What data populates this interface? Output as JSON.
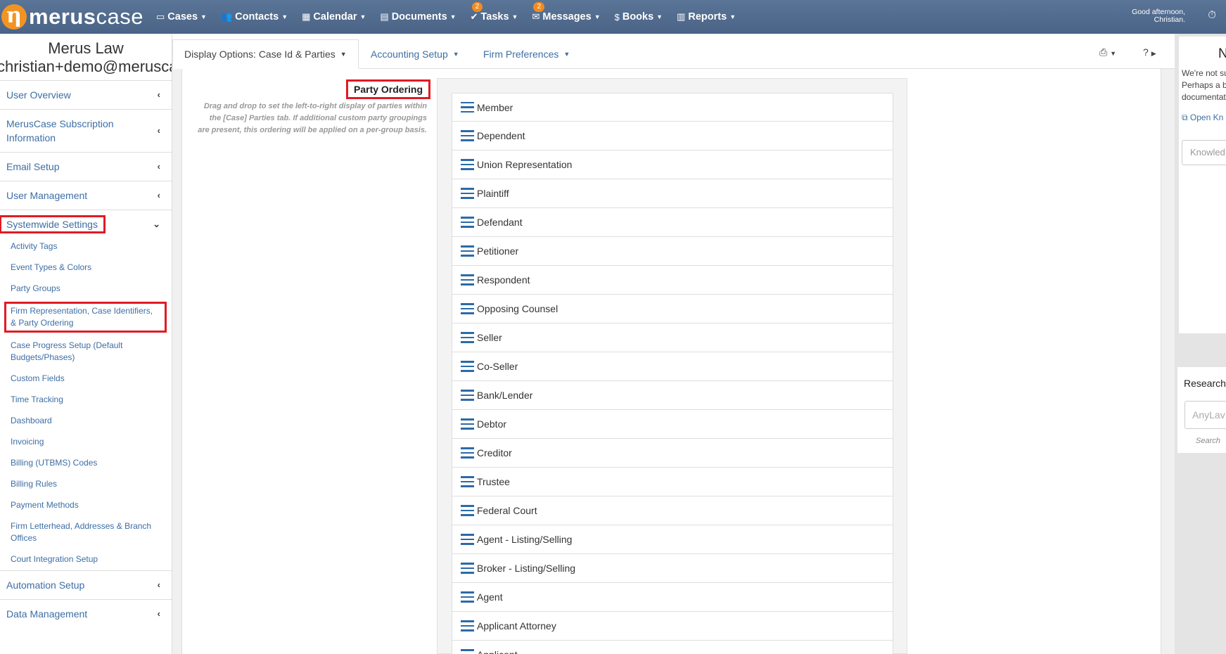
{
  "topbar": {
    "logo_text_bold": "merus",
    "logo_text_light": "case",
    "nav": [
      {
        "label": "Cases",
        "icon": "folder-icon"
      },
      {
        "label": "Contacts",
        "icon": "users-icon"
      },
      {
        "label": "Calendar",
        "icon": "calendar-icon"
      },
      {
        "label": "Documents",
        "icon": "document-icon"
      },
      {
        "label": "Tasks",
        "icon": "check-circle-icon",
        "badge": "2"
      },
      {
        "label": "Messages",
        "icon": "envelope-icon",
        "badge": "2"
      },
      {
        "label": "Books",
        "icon": "dollar-circle-icon"
      },
      {
        "label": "Reports",
        "icon": "bar-chart-icon"
      }
    ],
    "greeting_line1": "Good afternoon,",
    "greeting_line2": "Christian."
  },
  "sidebar": {
    "firm_name": "Merus Law",
    "firm_email": "christian+demo@meruscase",
    "sections": [
      {
        "label": "User Overview"
      },
      {
        "label": "MerusCase Subscription Information"
      },
      {
        "label": "Email Setup"
      },
      {
        "label": "User Management"
      },
      {
        "label": "Systemwide Settings"
      }
    ],
    "sub_items": [
      "Activity Tags",
      "Event Types & Colors",
      "Party Groups",
      "Firm Representation, Case Identifiers, & Party Ordering",
      "Case Progress Setup (Default Budgets/Phases)",
      "Custom Fields",
      "Time Tracking",
      "Dashboard",
      "Invoicing",
      "Billing (UTBMS) Codes",
      "Billing Rules",
      "Payment Methods",
      "Firm Letterhead, Addresses & Branch Offices",
      "Court Integration Setup"
    ],
    "bottom_sections": [
      {
        "label": "Automation Setup"
      },
      {
        "label": "Data Management"
      }
    ]
  },
  "tabs": {
    "display_options": "Display Options: Case Id & Parties",
    "accounting_setup": "Accounting Setup",
    "firm_preferences": "Firm Preferences"
  },
  "party_ordering": {
    "title": "Party Ordering",
    "description": "Drag and drop to set the left-to-right display of parties within the [Case] Parties tab. If additional custom party groupings are present, this ordering will be applied on a per-group basis.",
    "parties": [
      "Member",
      "Dependent",
      "Union Representation",
      "Plaintiff",
      "Defendant",
      "Petitioner",
      "Respondent",
      "Opposing Counsel",
      "Seller",
      "Co-Seller",
      "Bank/Lender",
      "Debtor",
      "Creditor",
      "Trustee",
      "Federal Court",
      "Agent - Listing/Selling",
      "Broker - Listing/Selling",
      "Agent",
      "Applicant Attorney",
      "Applicant"
    ]
  },
  "right_panel": {
    "heading": "N",
    "text1": "We're not su",
    "text2": "Perhaps a b",
    "text3": "documentat",
    "link": "Open Kn",
    "kb_placeholder": "Knowled",
    "research_title": "Research",
    "anylaw_placeholder": "AnyLav",
    "search_label": "Search"
  },
  "colors": {
    "topbar": "#4f6a8d",
    "accent_orange": "#f28b1e",
    "link_blue": "#3d6ea5",
    "highlight_red": "#e01b24"
  }
}
